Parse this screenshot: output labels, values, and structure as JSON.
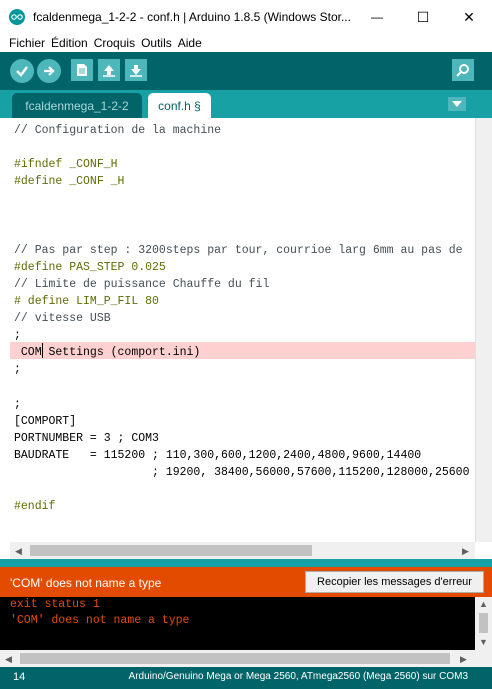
{
  "window": {
    "title": "fcaldenmega_1-2-2 - conf.h | Arduino 1.8.5 (Windows Stor...",
    "minimize_glyph": "—",
    "maximize_glyph": "☐",
    "close_glyph": "✕"
  },
  "menu": [
    "Fichier",
    "Édition",
    "Croquis",
    "Outils",
    "Aide"
  ],
  "toolbar": {
    "verify_icon": "check-icon",
    "upload_icon": "arrow-right-icon",
    "new_icon": "document-icon",
    "open_icon": "arrow-up-icon",
    "save_icon": "arrow-down-icon",
    "serial_icon": "magnifier-icon"
  },
  "tabs": [
    {
      "label": "fcaldenmega_1-2-2",
      "active": false
    },
    {
      "label": "conf.h §",
      "active": true
    }
  ],
  "editor": {
    "lines": [
      {
        "text": "// Configuration de la machine",
        "kind": "comment"
      },
      {
        "text": "",
        "kind": "plain"
      },
      {
        "text": "#ifndef _CONF_H",
        "kind": "kw"
      },
      {
        "text": "#define _CONF _H",
        "kind": "kw"
      },
      {
        "text": "",
        "kind": "plain"
      },
      {
        "text": "",
        "kind": "plain"
      },
      {
        "text": "",
        "kind": "plain"
      },
      {
        "text": "// Pas par step : 3200steps par tour, courrioe larg 6mm au pas de",
        "kind": "comment"
      },
      {
        "text": "#define PAS_STEP 0.025",
        "kind": "kw"
      },
      {
        "text": "// Limite de puissance Chauffe du fil",
        "kind": "comment"
      },
      {
        "text": "# define LIM_P_FIL 80",
        "kind": "kw"
      },
      {
        "text": "// vitesse USB",
        "kind": "comment"
      },
      {
        "text": ";",
        "kind": "plain"
      },
      {
        "text": " COM Settings (comport.ini)",
        "kind": "plain"
      },
      {
        "text": ";",
        "kind": "plain"
      },
      {
        "text": "",
        "kind": "plain"
      },
      {
        "text": ";",
        "kind": "plain"
      },
      {
        "text": "[COMPORT]",
        "kind": "plain"
      },
      {
        "text": "PORTNUMBER = 3 ; COM3",
        "kind": "plain"
      },
      {
        "text": "BAUDRATE   = 115200 ; 110,300,600,1200,2400,4800,9600,14400",
        "kind": "plain"
      },
      {
        "text": "                    ; 19200, 38400,56000,57600,115200,128000,25600",
        "kind": "plain"
      },
      {
        "text": "",
        "kind": "plain"
      },
      {
        "text": "#endif",
        "kind": "kw"
      }
    ],
    "highlight_color": "#ffd0d0"
  },
  "error": {
    "message": "'COM' does not name a type",
    "copy_button": "Recopier les messages d'erreur",
    "color": "#e34c00"
  },
  "console": {
    "lines": [
      "exit status 1",
      "'COM' does not name a type"
    ]
  },
  "status": {
    "line_number": "14",
    "board": "Arduino/Genuino Mega or Mega 2560, ATmega2560 (Mega 2560) sur COM3"
  },
  "colors": {
    "toolbar": "#006468",
    "tabs_bar": "#17a1a5",
    "button": "#4db7bb"
  }
}
